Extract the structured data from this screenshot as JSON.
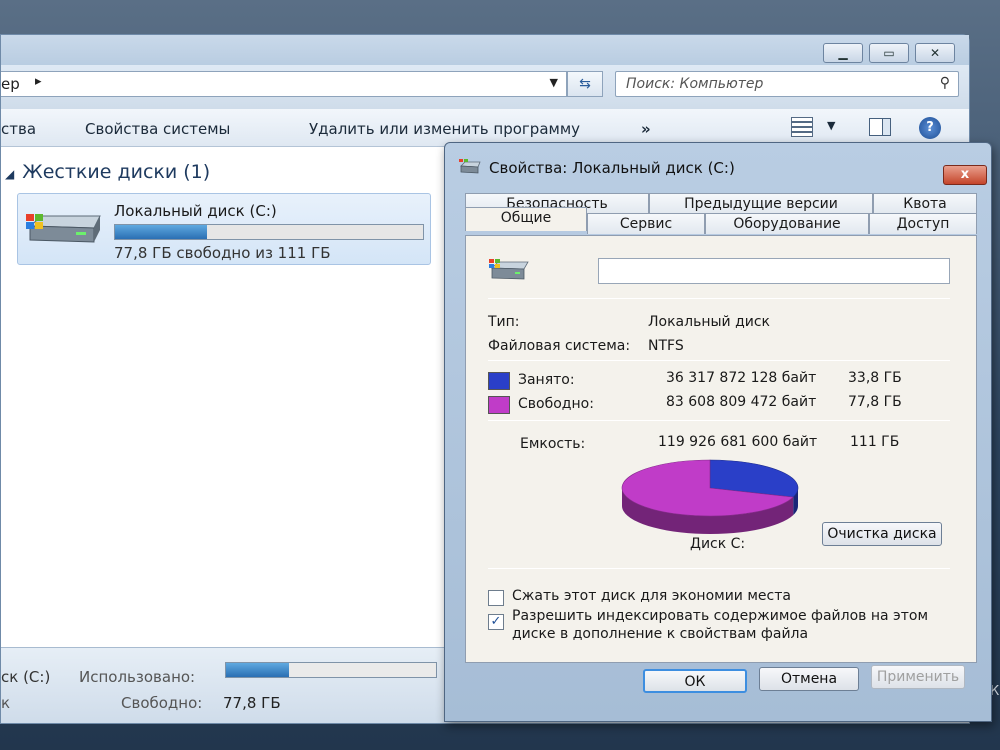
{
  "explorer": {
    "address_crumb": "ер",
    "search_placeholder": "Поиск: Компьютер",
    "commands": {
      "partial": "ства",
      "system_properties": "Свойства системы",
      "uninstall": "Удалить или изменить программу",
      "more": "»"
    },
    "group_header": "Жесткие диски (1)",
    "drive": {
      "name": "Локальный диск (C:)",
      "free_text": "77,8 ГБ свободно из 111 ГБ",
      "used_fraction": 0.3
    },
    "details": {
      "name": "ск (C:)",
      "used_label": "Использовано:",
      "used_fraction": 0.3,
      "free_label": "Свободно:",
      "free_value": "77,8 ГБ",
      "sys_partial": "к"
    }
  },
  "dialog": {
    "title": "Свойства: Локальный диск (C:)",
    "close_glyph": "x",
    "tabs_row1": [
      "Безопасность",
      "Предыдущие версии",
      "Квота"
    ],
    "tabs_row2": [
      "Общие",
      "Сервис",
      "Оборудование",
      "Доступ"
    ],
    "active_tab": "Общие",
    "name_field_value": "",
    "type_label": "Тип:",
    "type_value": "Локальный диск",
    "fs_label": "Файловая система:",
    "fs_value": "NTFS",
    "used": {
      "label": "Занято:",
      "bytes": "36 317 872 128 байт",
      "gb": "33,8 ГБ",
      "color": "#2a3fc8"
    },
    "free": {
      "label": "Свободно:",
      "bytes": "83 608 809 472 байт",
      "gb": "77,8 ГБ",
      "color": "#c03cc8"
    },
    "capacity": {
      "label": "Емкость:",
      "bytes": "119 926 681 600 байт",
      "gb": "111 ГБ"
    },
    "chart_data": {
      "type": "pie",
      "categories": [
        "Занято",
        "Свободно"
      ],
      "values": [
        36317872128,
        83608809472
      ],
      "colors": [
        "#2a3fc8",
        "#c03cc8"
      ]
    },
    "disk_label": "Диск C:",
    "cleanup_button": "Очистка диска",
    "compress_label": "Сжать этот диск для экономии места",
    "compress_checked": false,
    "index_label_line1": "Разрешить индексировать содержимое файлов на этом",
    "index_label_line2": "диске в дополнение к свойствам файла",
    "index_checked": true,
    "ok": "ОК",
    "cancel": "Отмена",
    "apply": "Применить"
  },
  "misc": {
    "right_edge_partial": "К"
  }
}
